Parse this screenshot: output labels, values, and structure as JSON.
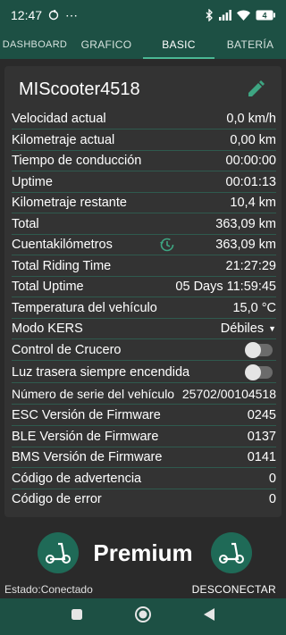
{
  "statusbar": {
    "time": "12:47",
    "dots": "⋯",
    "battery": "4"
  },
  "tabs": [
    {
      "label": "DASHBOARD"
    },
    {
      "label": "GRAFICO"
    },
    {
      "label": "BASIC"
    },
    {
      "label": "BATERÍA"
    }
  ],
  "card": {
    "title": "MIScooter4518",
    "rows": [
      {
        "label": "Velocidad actual",
        "value": "0,0 km/h"
      },
      {
        "label": "Kilometraje actual",
        "value": "0,00 km"
      },
      {
        "label": "Tiempo de conducción",
        "value": "00:00:00"
      },
      {
        "label": "Uptime",
        "value": "00:01:13"
      },
      {
        "label": "Kilometraje restante",
        "value": "10,4 km"
      },
      {
        "label": "Total",
        "value": "363,09 km"
      },
      {
        "label": "Cuentakilómetros",
        "value": "363,09 km"
      },
      {
        "label": "Total Riding Time",
        "value": "21:27:29"
      },
      {
        "label": "Total Uptime",
        "value": "05 Days 11:59:45"
      },
      {
        "label": "Temperatura del vehículo",
        "value": "15,0 °C"
      },
      {
        "label": "Modo KERS",
        "value": "Débiles"
      },
      {
        "label": "Control de Crucero",
        "value": ""
      },
      {
        "label": "Luz trasera siempre encendida",
        "value": ""
      },
      {
        "label": "Número de serie del vehículo",
        "value": "25702/00104518"
      },
      {
        "label": "ESC Versión de Firmware",
        "value": "0245"
      },
      {
        "label": "BLE Versión de Firmware",
        "value": "0137"
      },
      {
        "label": "BMS Versión de Firmware",
        "value": "0141"
      },
      {
        "label": "Código de advertencia",
        "value": "0"
      },
      {
        "label": "Código de error",
        "value": "0"
      }
    ],
    "toggles": {
      "cruise_control": false,
      "tail_light": false
    }
  },
  "promo": {
    "label": "Premium"
  },
  "footer": {
    "status": "Estado:Conectado",
    "disconnect": "DESCONECTAR"
  },
  "colors": {
    "bar": "#1d5044",
    "accent": "#4ab894",
    "background": "#2a2a2a",
    "card": "#333333"
  }
}
